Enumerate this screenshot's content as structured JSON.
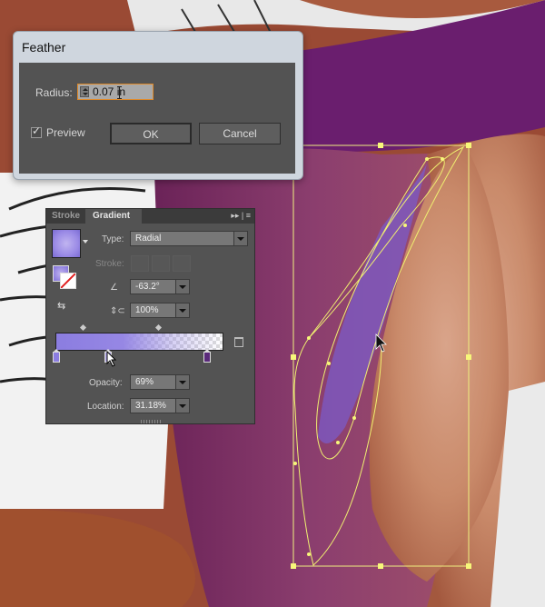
{
  "feather_dialog": {
    "title": "Feather",
    "radius_label": "Radius:",
    "radius_value": "0.07 in",
    "preview_label": "Preview",
    "preview_checked": true,
    "ok_label": "OK",
    "cancel_label": "Cancel"
  },
  "gradient_panel": {
    "tabs": [
      "Stroke",
      "Gradient"
    ],
    "type_label": "Type:",
    "type_value": "Radial",
    "stroke_label": "Stroke:",
    "angle_value": "-63.2°",
    "aspect_value": "100%",
    "opacity_label": "Opacity:",
    "opacity_value": "69%",
    "location_label": "Location:",
    "location_value": "31.18%",
    "colors": {
      "stop_left": "#8b7de0",
      "stop_right": "#5a2a7a",
      "accent": "#e08a2a"
    }
  },
  "icons": {
    "tab_menu": "panel-menu-icon",
    "delete_stop": "trash-icon",
    "angle": "angle-icon",
    "aspect": "aspect-ratio-icon",
    "reverse": "reverse-gradient-icon"
  }
}
